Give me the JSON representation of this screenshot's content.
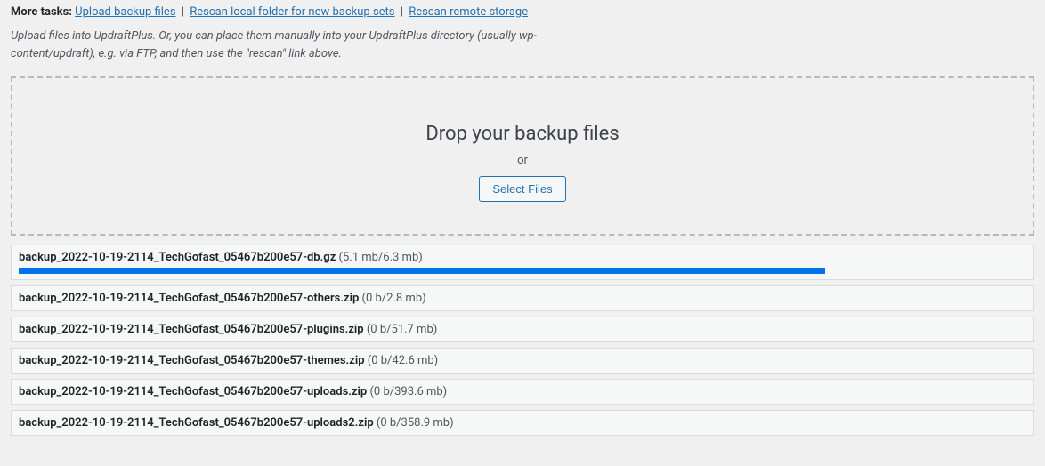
{
  "tasks": {
    "label": "More tasks:",
    "upload": "Upload backup files",
    "rescan_local": "Rescan local folder for new backup sets",
    "rescan_remote": "Rescan remote storage",
    "sep": "|"
  },
  "instruction": "Upload files into UpdraftPlus. Or, you can place them manually into your UpdraftPlus directory (usually wp-content/updraft), e.g. via FTP, and then use the \"rescan\" link above.",
  "dropzone": {
    "heading": "Drop your backup files",
    "or": "or",
    "select": "Select Files"
  },
  "uploads": [
    {
      "name": "backup_2022-10-19-2114_TechGofast_05467b200e57-db.gz",
      "size": "(5.1 mb/6.3 mb)",
      "progress_pct": 80
    },
    {
      "name": "backup_2022-10-19-2114_TechGofast_05467b200e57-others.zip",
      "size": "(0 b/2.8 mb)",
      "progress_pct": 0
    },
    {
      "name": "backup_2022-10-19-2114_TechGofast_05467b200e57-plugins.zip",
      "size": "(0 b/51.7 mb)",
      "progress_pct": 0
    },
    {
      "name": "backup_2022-10-19-2114_TechGofast_05467b200e57-themes.zip",
      "size": "(0 b/42.6 mb)",
      "progress_pct": 0
    },
    {
      "name": "backup_2022-10-19-2114_TechGofast_05467b200e57-uploads.zip",
      "size": "(0 b/393.6 mb)",
      "progress_pct": 0
    },
    {
      "name": "backup_2022-10-19-2114_TechGofast_05467b200e57-uploads2.zip",
      "size": "(0 b/358.9 mb)",
      "progress_pct": 0
    }
  ]
}
